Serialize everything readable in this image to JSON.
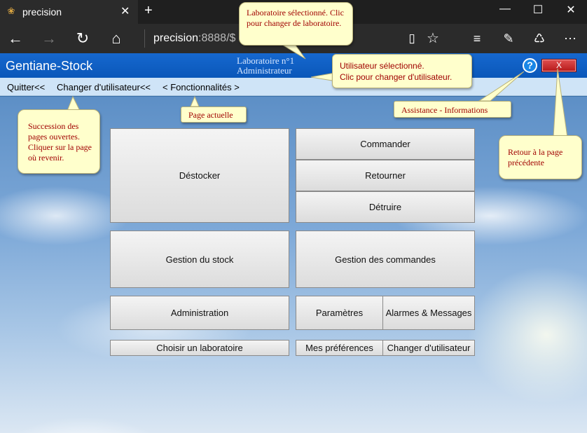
{
  "browser": {
    "tab_title": "precision",
    "tab_close": "✕",
    "new_tab": "+",
    "address_host": "precision",
    "address_rest": ":8888/$",
    "window_controls": {
      "minimize": "—",
      "maximize": "☐",
      "close": "✕"
    }
  },
  "app": {
    "title": "Gentiane-Stock",
    "lab_line1": "Laboratoire n°1",
    "lab_line2": "Administrateur",
    "help_label": "?",
    "exit_label": "X"
  },
  "menu": {
    "quit": "Quitter<<",
    "change_user": "Changer d'utilisateur<<",
    "features": "< Fonctionnalités >"
  },
  "tiles": {
    "destocker": "Déstocker",
    "commander": "Commander",
    "retourner": "Retourner",
    "detruire": "Détruire",
    "gestion_stock": "Gestion du stock",
    "gestion_commandes": "Gestion des commandes",
    "administration": "Administration",
    "parametres": "Paramètres",
    "alarmes": "Alarmes & Messages",
    "choisir_labo": "Choisir un laboratoire",
    "preferences": "Mes préférences",
    "changer_utilisateur": "Changer d'utilisateur"
  },
  "callouts": {
    "lab_selected": "Laboratoire sélectionné. Clic pour changer de laboratoire.",
    "user_selected_1": "Utilisateur sélectionné.",
    "user_selected_2": "Clic pour changer d'utilisateur.",
    "current_page": "Page actuelle",
    "history": "Succession des pages ouvertes. Cliquer sur la page où revenir.",
    "assistance": "Assistance - Informations",
    "back": "Retour à la page précédente"
  },
  "icons": [
    "app-icon",
    "close-icon",
    "plus-icon",
    "back-icon",
    "forward-icon",
    "refresh-icon",
    "home-icon",
    "reading-view-icon",
    "favorite-star-icon",
    "hub-icon",
    "note-icon",
    "share-icon",
    "more-icon",
    "help-icon"
  ]
}
